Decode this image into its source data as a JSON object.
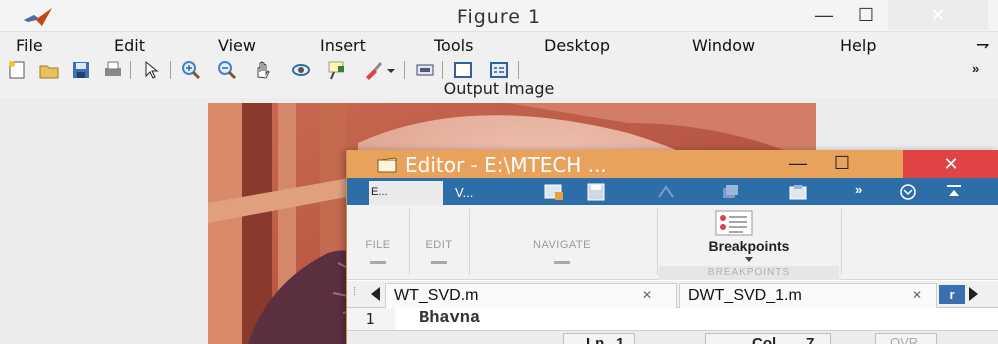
{
  "figure": {
    "title": "Figure 1",
    "menu": [
      "File",
      "Edit",
      "View",
      "Insert",
      "Tools",
      "Desktop",
      "Window",
      "Help"
    ],
    "menu_more": "⇁",
    "toolbar_more": "»",
    "axes_title": "Output Image"
  },
  "editor": {
    "title": "Editor - E:\\MTECH ...",
    "tab1_label": "E...",
    "tab2_label": "V...",
    "qa_more": "»",
    "ribbon": {
      "file": "FILE",
      "edit": "EDIT",
      "navigate": "NAVIGATE",
      "breakpoints_button": "Breakpoints",
      "breakpoints_section": "BREAKPOINTS"
    },
    "doc_tabs": [
      {
        "name": "WT_SVD.m"
      },
      {
        "name": "DWT_SVD_1.m"
      }
    ],
    "doc_tab_close": "✕",
    "doc_tabs_more": "r",
    "code": {
      "line_number": "1",
      "text": "Bhavna"
    },
    "status": {
      "ln_label": "Ln",
      "ln_value": "1",
      "col_label": "Col",
      "col_value": "7",
      "ovr": "OVR"
    }
  },
  "window_buttons": {
    "minimize": "—",
    "maximize": "☐",
    "close": "✕"
  }
}
